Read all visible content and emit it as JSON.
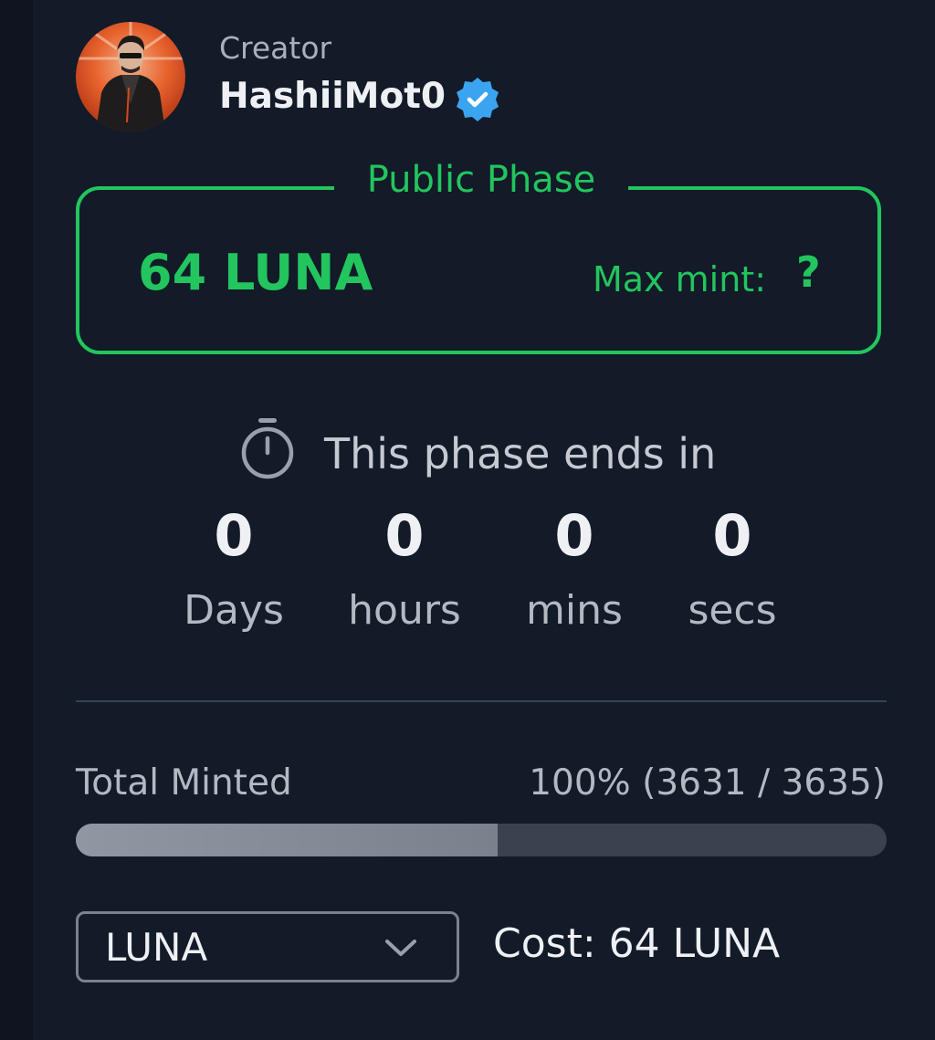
{
  "creator": {
    "label": "Creator",
    "name": "HashiiMot0",
    "verified": true
  },
  "phase": {
    "title": "Public Phase",
    "price": "64 LUNA",
    "max_mint_label": "Max mint:",
    "max_mint_value": "?"
  },
  "countdown": {
    "label": "This phase ends in",
    "days": "0",
    "days_label": "Days",
    "hours": "0",
    "hours_label": "hours",
    "mins": "0",
    "mins_label": "mins",
    "secs": "0",
    "secs_label": "secs"
  },
  "minted": {
    "label": "Total Minted",
    "value_text": "100% (3631 / 3635)",
    "minted": 3631,
    "total": 3635,
    "bar_fill_fraction": 0.52
  },
  "purchase": {
    "currency": "LUNA",
    "cost_text": "Cost: 64 LUNA"
  },
  "colors": {
    "accent_green": "#22c55e",
    "verified_blue": "#3ba4f0",
    "background": "#131a28"
  },
  "icons": {
    "verified": "verified-badge-icon",
    "timer": "stopwatch-icon",
    "chevron": "chevron-down-icon"
  }
}
